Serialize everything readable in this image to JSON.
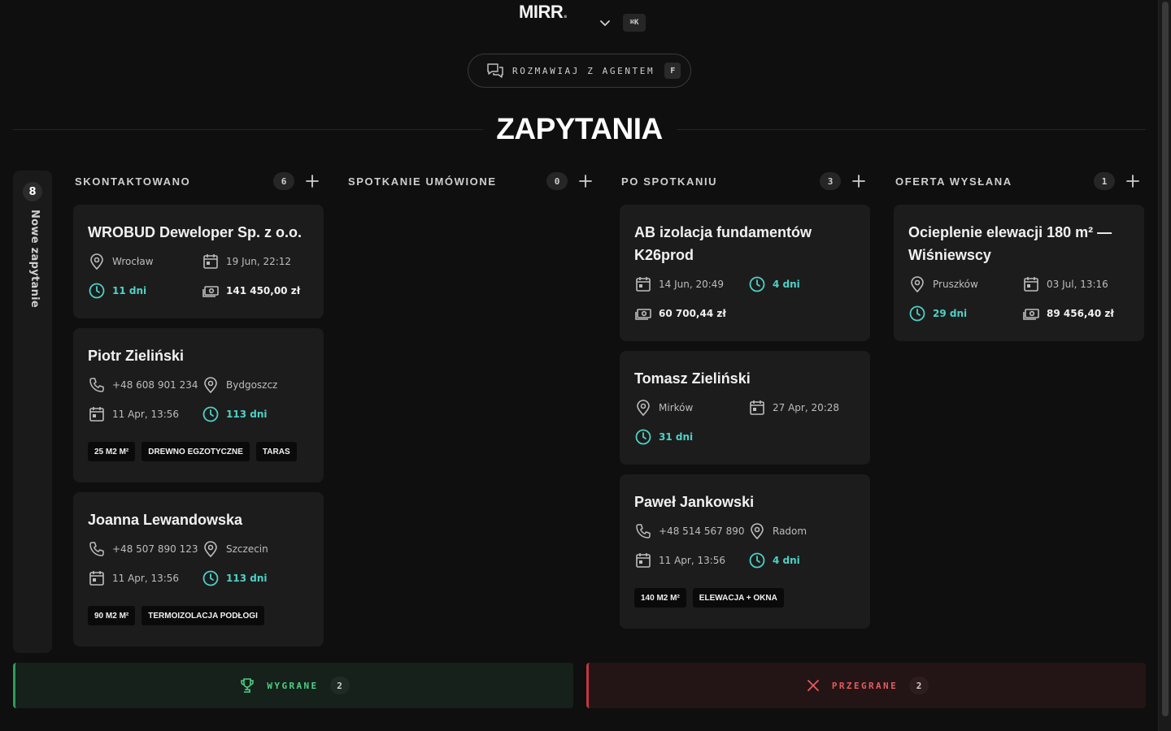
{
  "app": {
    "logo_text": "MIRR",
    "logo_dot": ".",
    "shortcut": "⌘K"
  },
  "agent_button": {
    "label": "ROZMAWIAJ Z AGENTEM",
    "key": "F"
  },
  "page_title": "ZAPYTANIA",
  "rail": {
    "count": "8",
    "label": "Nowe zapytanie"
  },
  "columns": [
    {
      "title": "SKONTAKTOWANO",
      "count": "6",
      "cards": [
        {
          "title": "WROBUD Deweloper Sp. z o.o.",
          "location": "Wrocław",
          "date": "19 Jun, 22:12",
          "days": "11 dni",
          "amount": "141 450,00 zł"
        },
        {
          "title": "Piotr Zieliński",
          "phone": "+48 608 901 234",
          "location": "Bydgoszcz",
          "date": "11 Apr, 13:56",
          "days": "113 dni",
          "tags": [
            "25 M2 M²",
            "DREWNO EGZOTYCZNE",
            "TARAS"
          ]
        },
        {
          "title": "Joanna Lewandowska",
          "phone": "+48 507 890 123",
          "location": "Szczecin",
          "date": "11 Apr, 13:56",
          "days": "113 dni",
          "tags": [
            "90 M2 M²",
            "TERMOIZOLACJA PODŁOGI"
          ]
        }
      ]
    },
    {
      "title": "SPOTKANIE UMÓWIONE",
      "count": "0",
      "cards": []
    },
    {
      "title": "PO SPOTKANIU",
      "count": "3",
      "cards": [
        {
          "title": "AB izolacja fundamentów K26prod",
          "date": "14 Jun, 20:49",
          "days": "4 dni",
          "amount": "60 700,44 zł"
        },
        {
          "title": "Tomasz Zieliński",
          "location": "Mirków",
          "date": "27 Apr, 20:28",
          "days": "31 dni"
        },
        {
          "title": "Paweł Jankowski",
          "phone": "+48 514 567 890",
          "location": "Radom",
          "date": "11 Apr, 13:56",
          "days": "4 dni",
          "tags": [
            "140 M2 M²",
            "ELEWACJA + OKNA"
          ]
        }
      ]
    },
    {
      "title": "OFERTA WYSŁANA",
      "count": "1",
      "cards": [
        {
          "title": "Ocieplenie elewacji 180 m² — Wiśniewscy",
          "location": "Pruszków",
          "date": "03 Jul, 13:16",
          "days": "29 dni",
          "amount": "89 456,40 zł"
        }
      ]
    }
  ],
  "won": {
    "label": "WYGRANE",
    "count": "2"
  },
  "lost": {
    "label": "PRZEGRANE",
    "count": "2"
  },
  "colors": {
    "teal": "#4fd1c5",
    "won": "#4fcf83",
    "lost": "#e65a5f",
    "card": "#1c1c1c"
  },
  "icons": [
    "chevron-down-icon",
    "chat-icon",
    "plus-icon",
    "map-pin-icon",
    "calendar-icon",
    "clock-icon",
    "money-icon",
    "phone-icon",
    "trophy-icon",
    "close-icon"
  ]
}
